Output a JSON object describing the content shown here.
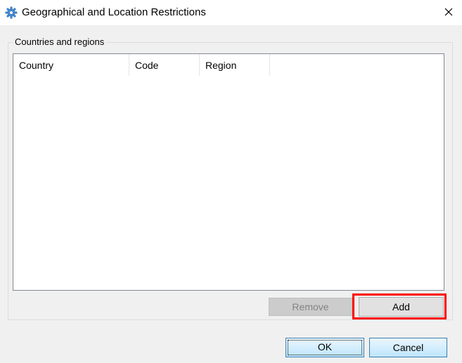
{
  "window": {
    "title": "Geographical and Location Restrictions",
    "icon": "gear-icon",
    "close_icon": "close-icon"
  },
  "group": {
    "label": "Countries and regions"
  },
  "list": {
    "columns": [
      "Country",
      "Code",
      "Region"
    ],
    "rows": []
  },
  "buttons": {
    "remove": "Remove",
    "add": "Add",
    "ok": "OK",
    "cancel": "Cancel"
  },
  "colors": {
    "highlight": "#ff0000",
    "disabled_button": "#cccccc",
    "primary_border": "#3c7fb1"
  }
}
